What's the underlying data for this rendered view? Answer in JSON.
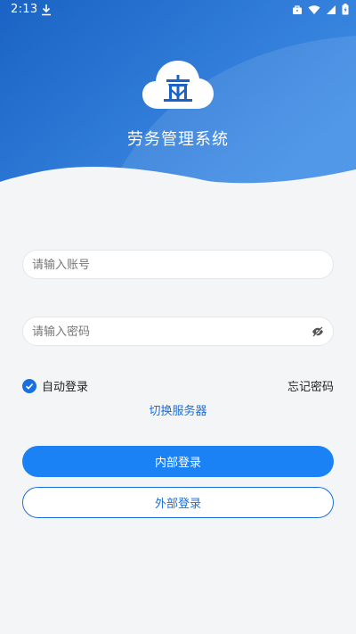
{
  "status_bar": {
    "time": "2:13",
    "icons": [
      "download-icon",
      "briefcase-icon",
      "wifi-icon",
      "signal-icon",
      "battery-icon"
    ]
  },
  "app": {
    "title": "劳务管理系统",
    "logo_icon": "cloud-building-icon"
  },
  "form": {
    "account_placeholder": "请输入账号",
    "password_placeholder": "请输入密码",
    "password_visibility_icon": "eye-off-icon",
    "remember_label": "自动登录",
    "remember_checked": true,
    "forgot_label": "忘记密码",
    "switch_server_label": "切换服务器"
  },
  "buttons": {
    "internal_login": "内部登录",
    "external_login": "外部登录"
  },
  "colors": {
    "primary": "#1a82f5",
    "hero_dark": "#1565c8",
    "hero_light": "#4a95e8",
    "background": "#f4f5f7"
  }
}
